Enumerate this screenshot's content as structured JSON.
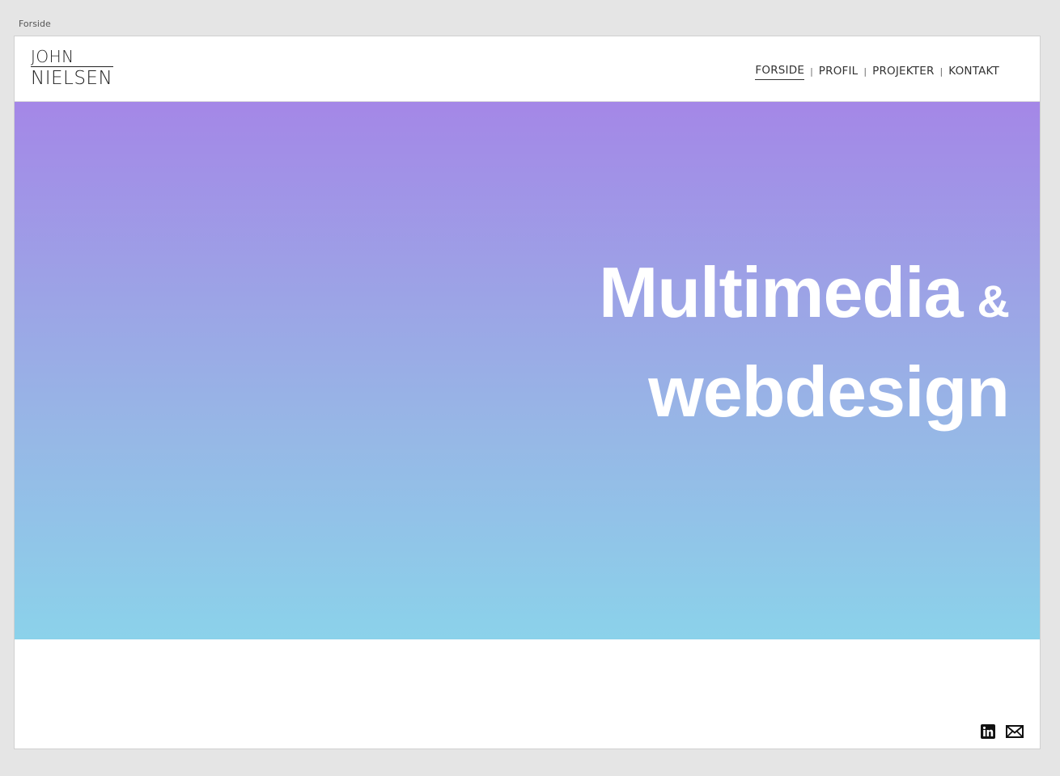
{
  "artboard": {
    "label": "Forside"
  },
  "logo": {
    "line1": "JOHN",
    "line2": "NIELSEN"
  },
  "nav": {
    "items": [
      {
        "label": "FORSIDE",
        "active": true
      },
      {
        "label": "PROFIL",
        "active": false
      },
      {
        "label": "PROJEKTER",
        "active": false
      },
      {
        "label": "KONTAKT",
        "active": false
      }
    ],
    "separator": "|"
  },
  "hero": {
    "line1": "Multimedia",
    "ampersand": "&",
    "line2": "webdesign",
    "gradient_top": "#a487e7",
    "gradient_bottom": "#8bd2ea"
  },
  "footer": {
    "icons": [
      "linkedin-icon",
      "mail-icon"
    ]
  }
}
